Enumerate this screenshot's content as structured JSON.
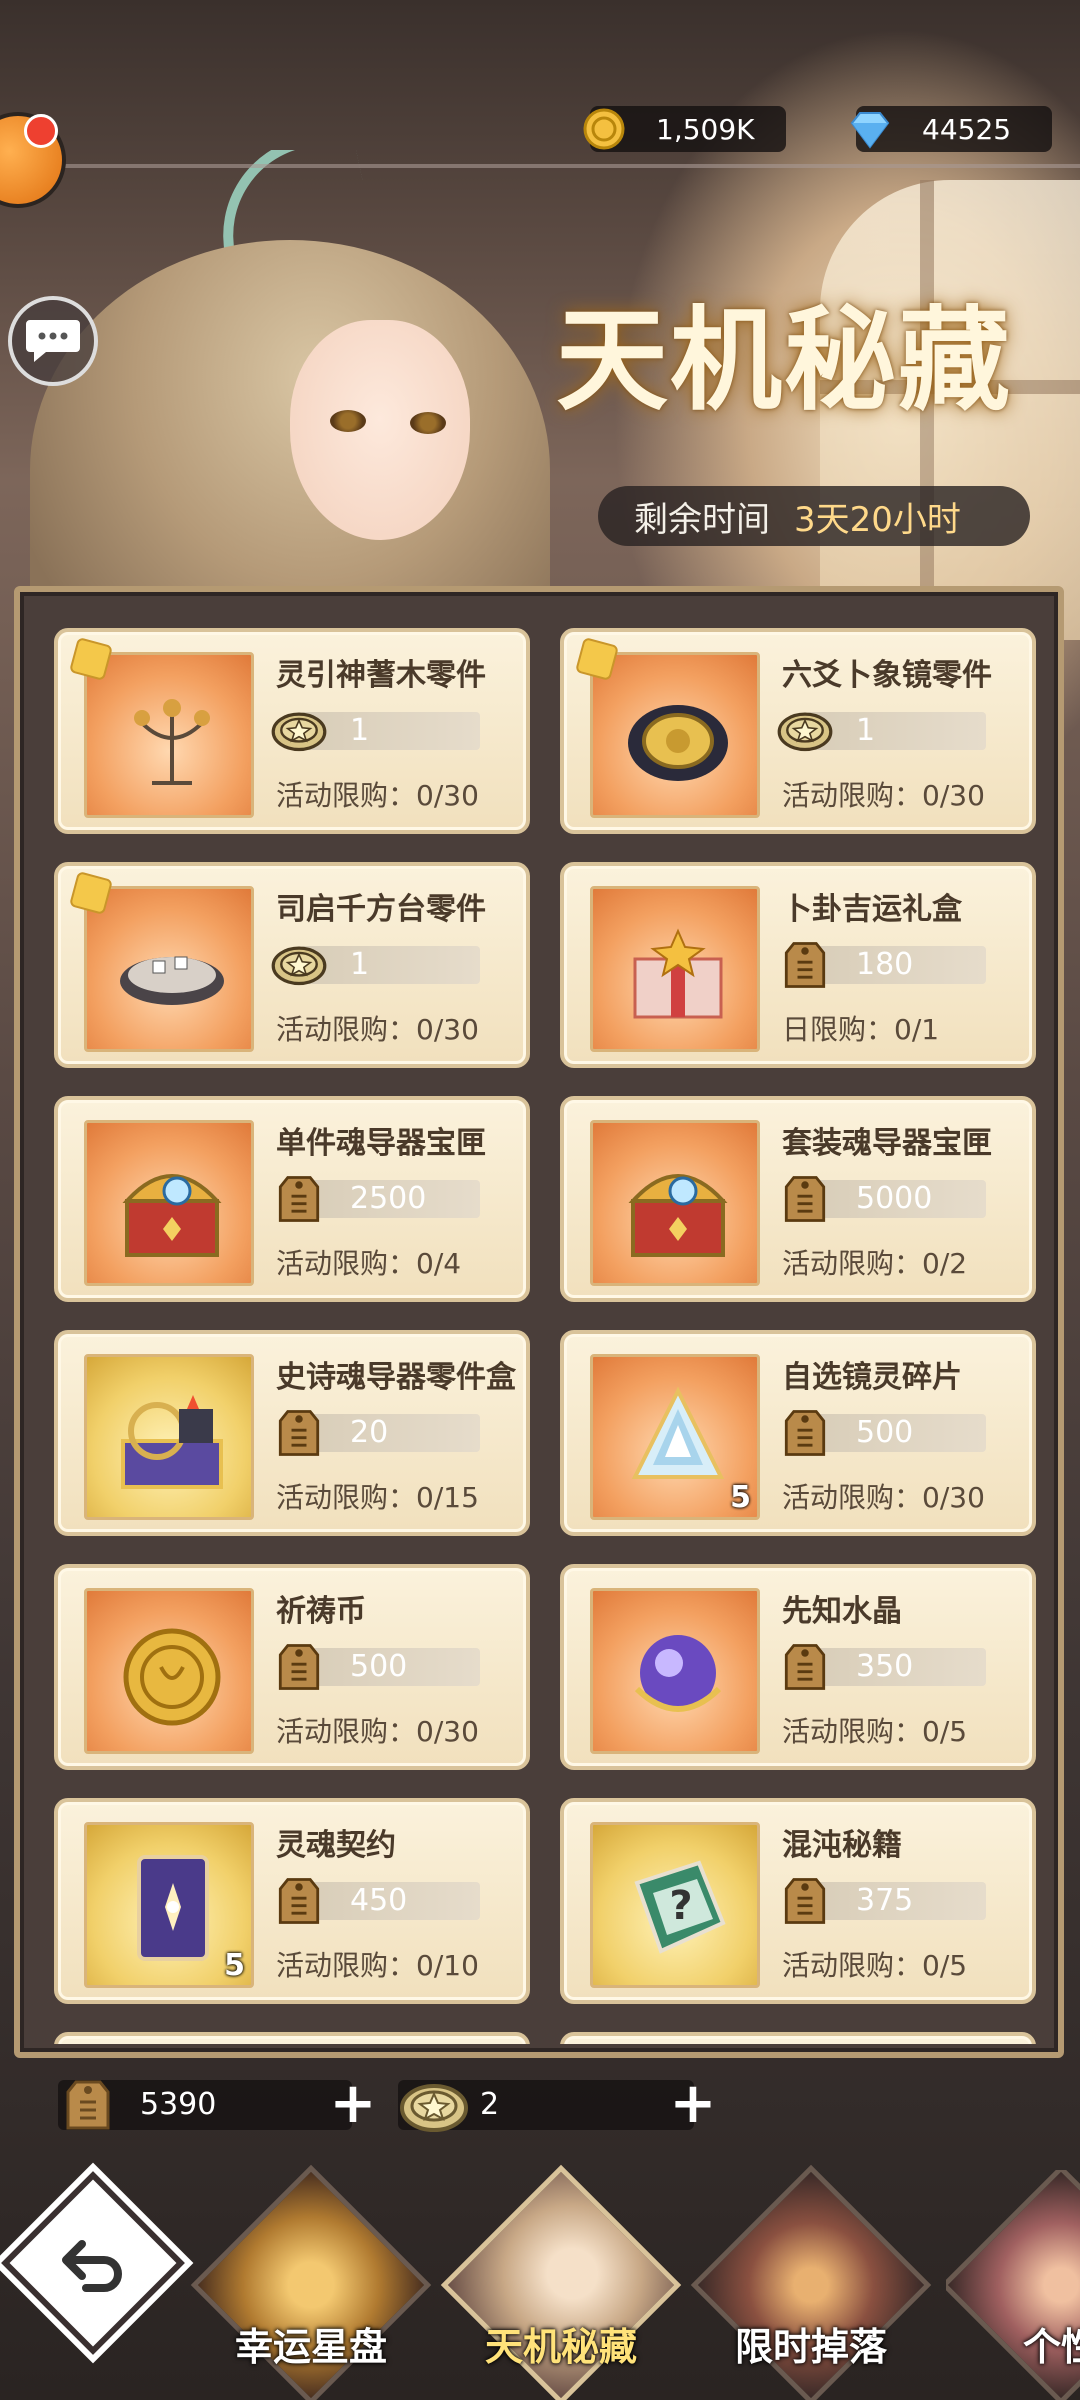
{
  "header": {
    "gold": {
      "icon": "gold-coin-icon",
      "value": "1,509K"
    },
    "diamond": {
      "icon": "diamond-icon",
      "value": "44525"
    }
  },
  "event": {
    "title": "天机秘藏",
    "timer_label": "剩余时间",
    "timer_value": "3天20小时"
  },
  "shop_items": [
    {
      "name": "灵引神蓍木零件",
      "icon": "candelabra-part-icon",
      "currency": "token",
      "price": "1",
      "limit": "活动限购：0/30",
      "frame": "orange",
      "puzzle": true
    },
    {
      "name": "六爻卜象镜零件",
      "icon": "mirror-part-icon",
      "currency": "token",
      "price": "1",
      "limit": "活动限购：0/30",
      "frame": "orange",
      "puzzle": true
    },
    {
      "name": "司启千方台零件",
      "icon": "platform-part-icon",
      "currency": "token",
      "price": "1",
      "limit": "活动限购：0/30",
      "frame": "orange",
      "puzzle": true
    },
    {
      "name": "卜卦吉运礼盒",
      "icon": "gift-box-icon",
      "currency": "tag",
      "price": "180",
      "limit": "日限购：0/1",
      "frame": "orange",
      "puzzle": false
    },
    {
      "name": "单件魂导器宝匣",
      "icon": "treasure-chest-icon",
      "currency": "tag",
      "price": "2500",
      "limit": "活动限购：0/4",
      "frame": "orange",
      "puzzle": false
    },
    {
      "name": "套装魂导器宝匣",
      "icon": "treasure-chest-icon",
      "currency": "tag",
      "price": "5000",
      "limit": "活动限购：0/2",
      "frame": "orange",
      "puzzle": false
    },
    {
      "name": "史诗魂导器零件盒",
      "icon": "parts-box-icon",
      "currency": "tag",
      "price": "20",
      "limit": "活动限购：0/15",
      "frame": "gold",
      "puzzle": false
    },
    {
      "name": "自选镜灵碎片",
      "icon": "crystal-shard-icon",
      "currency": "tag",
      "price": "500",
      "limit": "活动限购：0/30",
      "frame": "orange",
      "puzzle": false,
      "count": "5"
    },
    {
      "name": "祈祷币",
      "icon": "prayer-coin-icon",
      "currency": "tag",
      "price": "500",
      "limit": "活动限购：0/30",
      "frame": "orange",
      "puzzle": false
    },
    {
      "name": "先知水晶",
      "icon": "crystal-ball-icon",
      "currency": "tag",
      "price": "350",
      "limit": "活动限购：0/5",
      "frame": "orange",
      "puzzle": false
    },
    {
      "name": "灵魂契约",
      "icon": "contract-card-icon",
      "currency": "tag",
      "price": "450",
      "limit": "活动限购：0/10",
      "frame": "gold",
      "puzzle": false,
      "count": "5"
    },
    {
      "name": "混沌秘籍",
      "icon": "mystery-book-icon",
      "currency": "tag",
      "price": "375",
      "limit": "活动限购：0/5",
      "frame": "gold",
      "puzzle": false
    }
  ],
  "balances": {
    "tag": {
      "icon": "bamboo-tag-icon",
      "value": "5390"
    },
    "token": {
      "icon": "star-token-icon",
      "value": "2"
    }
  },
  "nav": {
    "back_icon": "back-arrow-icon",
    "tabs": [
      {
        "label": "幸运星盘",
        "active": false
      },
      {
        "label": "天机秘藏",
        "active": true
      },
      {
        "label": "限时掉落",
        "active": false
      },
      {
        "label": "个性",
        "active": false
      }
    ]
  },
  "colors": {
    "accent": "#ffe27a",
    "card_bg": "#fbf2dc",
    "timer_value": "#ffd98a"
  }
}
